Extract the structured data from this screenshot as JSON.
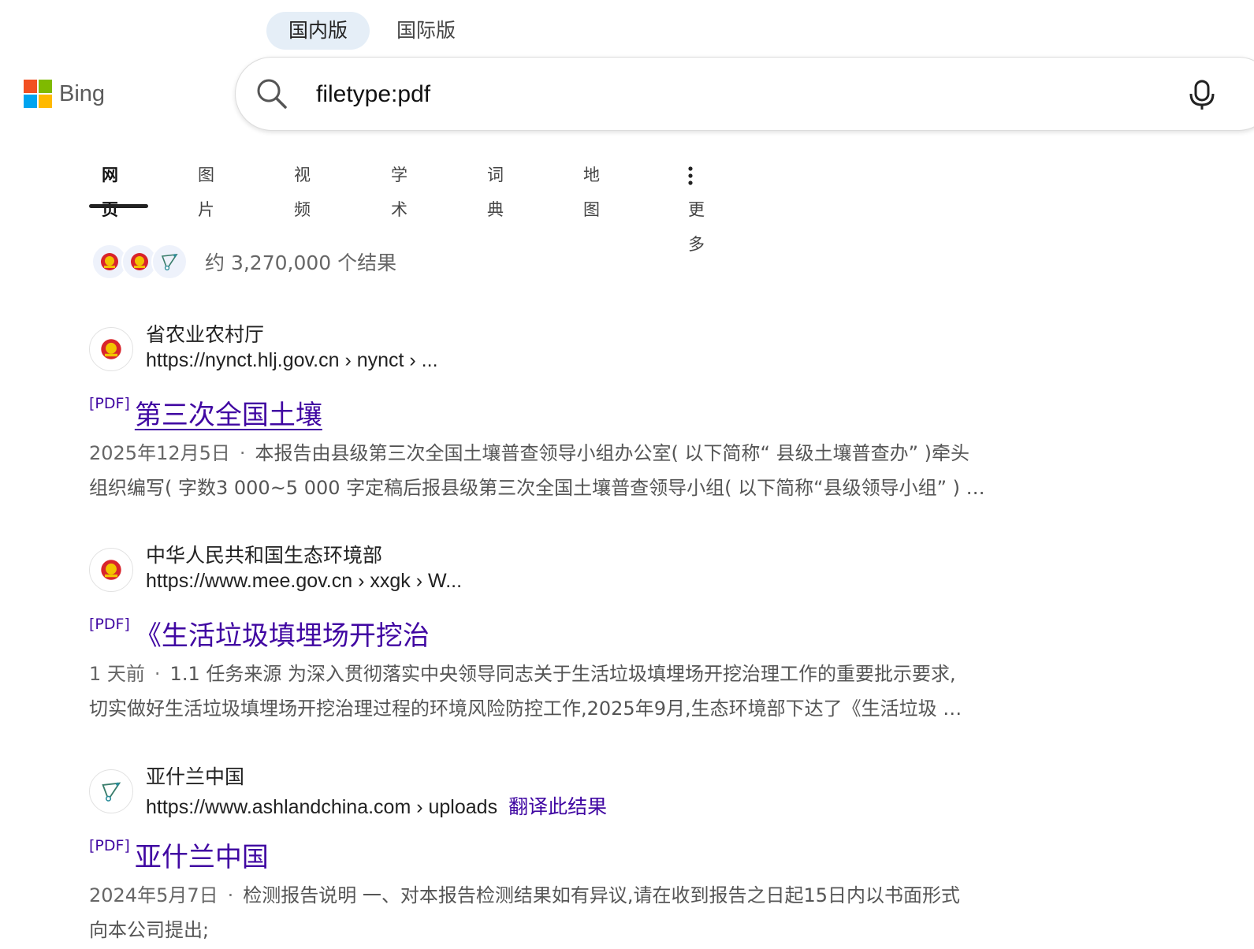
{
  "region_tabs": {
    "domestic": "国内版",
    "international": "国际版"
  },
  "logo": {
    "text": "Bing"
  },
  "search": {
    "query": "filetype:pdf"
  },
  "nav": {
    "web": "网页",
    "images": "图片",
    "videos": "视频",
    "academic": "学术",
    "dictionary": "词典",
    "maps": "地图",
    "more": "更多"
  },
  "result_count": "约 3,270,000 个结果",
  "results": [
    {
      "site_name": "省农业农村厅",
      "url": "https://nynct.hlj.gov.cn › nynct › ...",
      "tag": "[PDF]",
      "title": "第三次全国土壤",
      "date": "2025年12月5日",
      "line1": "本报告由县级第三次全国土壤普查领导小组办公室( 以下简称“ 县级土壤普查办” )牵头",
      "line2": "组织编写( 字数3 000~5 000 字定稿后报县级第三次全国土壤普查领导小组( 以下简称“县级领导小组” ) …"
    },
    {
      "site_name": "中华人民共和国生态环境部",
      "url": "https://www.mee.gov.cn › xxgk › W...",
      "tag": "[PDF]",
      "title": "《生活垃圾填埋场开挖治",
      "date": "1 天前",
      "line1": "1.1 任务来源 为深入贯彻落实中央领导同志关于生活垃圾填埋场开挖治理工作的重要批示要求,",
      "line2": "切实做好生活垃圾填埋场开挖治理过程的环境风险防控工作,2025年9月,生态环境部下达了《生活垃圾 …"
    },
    {
      "site_name": "亚什兰中国",
      "url": "https://www.ashlandchina.com › uploads",
      "translate": "翻译此结果",
      "tag": "[PDF]",
      "title": "亚什兰中国",
      "date": "2024年5月7日",
      "line1": "检测报告说明 一、对本报告检测结果如有异议,请在收到报告之日起15日内以书面形式",
      "line2": "向本公司提出;"
    }
  ],
  "colors": {
    "link": "#4007a2",
    "active_region_bg": "#e5eef7"
  }
}
